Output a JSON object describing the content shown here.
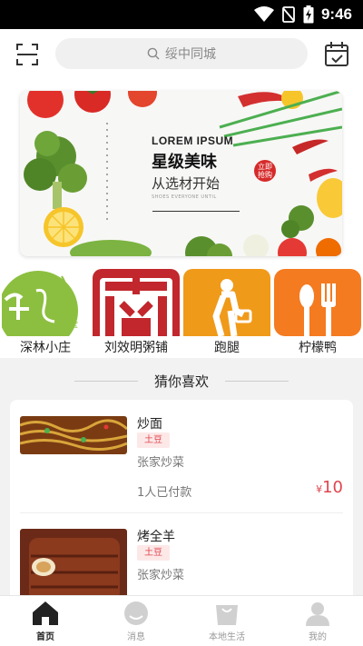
{
  "status_bar": {
    "time": "9:46",
    "icons": [
      "wifi-icon",
      "no-sim-icon",
      "battery-charging-icon"
    ]
  },
  "header": {
    "scan_icon": "scan-icon",
    "search": {
      "placeholder": "绥中同城",
      "icon": "search-icon"
    },
    "calendar_icon": "calendar-check-icon"
  },
  "banner": {
    "line1": "LOREM IPSUM",
    "line2": "星级美味",
    "line3": "从选材开始",
    "line4": "SHOES EVERYONE UNTIL",
    "seal_top": "立即",
    "seal_bottom": "抢购"
  },
  "shops": [
    {
      "name": "深林小庄"
    },
    {
      "name": "刘效明粥铺"
    },
    {
      "name": "跑腿"
    },
    {
      "name": "柠檬鸭"
    }
  ],
  "guess": {
    "title": "猜你喜欢"
  },
  "items": [
    {
      "title": "炒面",
      "tag": "土豆",
      "shop": "张家炒菜",
      "sold": "1人已付款",
      "currency": "¥",
      "price": "10"
    },
    {
      "title": "烤全羊",
      "tag": "土豆",
      "shop": "张家炒菜"
    }
  ],
  "bottom_nav": [
    {
      "label": "首页",
      "icon": "home-icon",
      "active": true
    },
    {
      "label": "消息",
      "icon": "message-icon",
      "active": false
    },
    {
      "label": "本地生活",
      "icon": "shopping-bag-icon",
      "active": false
    },
    {
      "label": "我的",
      "icon": "user-icon",
      "active": false
    }
  ],
  "colors": {
    "accent": "#e0454e",
    "shop2": "#c1272d",
    "shop3": "#f09a1a",
    "shop4": "#f47b20"
  }
}
